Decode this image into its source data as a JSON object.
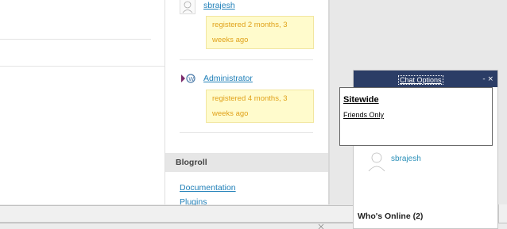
{
  "users": [
    {
      "name": "sbrajesh",
      "registered": "registered 2 months, 3 weeks ago"
    },
    {
      "name": "Administrator",
      "registered": "registered 4 months, 3 weeks ago"
    }
  ],
  "sidebar": {
    "blogroll_title": "Blogroll",
    "links": [
      "Documentation",
      "Plugins"
    ]
  },
  "chat": {
    "options_label": "Chat Options",
    "controls": "- ×",
    "dropdown": {
      "title": "Sitewide",
      "item": "Friends Only"
    },
    "online_user": "sbrajesh",
    "whos_online": "Who's Online (2)"
  },
  "icons": [
    "default-avatar-icon",
    "wordpress-logo-icon",
    "scroll-arrow-icon"
  ]
}
